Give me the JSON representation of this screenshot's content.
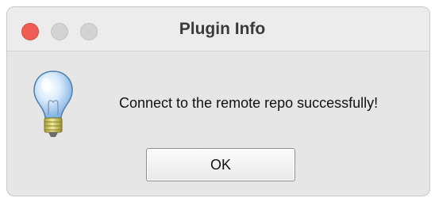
{
  "window": {
    "title": "Plugin Info"
  },
  "dialog": {
    "icon": "lightbulb-icon",
    "message": "Connect to the remote repo successfully!",
    "ok_label": "OK"
  },
  "colors": {
    "close": "#ee5e57",
    "inactive_traffic": "#d3d3d3",
    "background": "#e6e6e6"
  }
}
